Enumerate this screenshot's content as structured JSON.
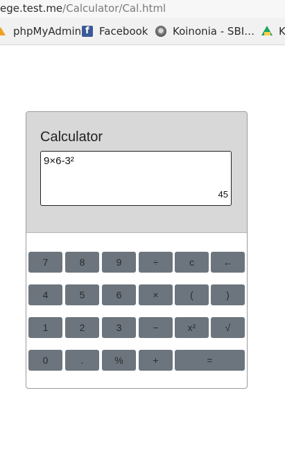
{
  "browser": {
    "url_host": "ege.test.me",
    "url_path": "/Calculator/Cal.html",
    "bookmarks": [
      {
        "label": "phpMyAdmin",
        "icon": "phpmyadmin-icon"
      },
      {
        "label": "Facebook",
        "icon": "facebook-icon"
      },
      {
        "label": "Koinonia - SBI…",
        "icon": "koinonia-icon"
      },
      {
        "label": "K",
        "icon": "google-drive-icon"
      }
    ]
  },
  "calculator": {
    "title": "Calculator",
    "expression": "9×6-3²",
    "result": "45",
    "keys": {
      "k7": "7",
      "k8": "8",
      "k9": "9",
      "divide": "÷",
      "clear": "c",
      "backspace": "←",
      "k4": "4",
      "k5": "5",
      "k6": "6",
      "multiply": "×",
      "lparen": "(",
      "rparen": ")",
      "k1": "1",
      "k2": "2",
      "k3": "3",
      "minus": "−",
      "square": "x²",
      "sqrt": "√",
      "k0": "0",
      "dot": ".",
      "percent": "%",
      "plus": "+",
      "equals": "="
    }
  }
}
